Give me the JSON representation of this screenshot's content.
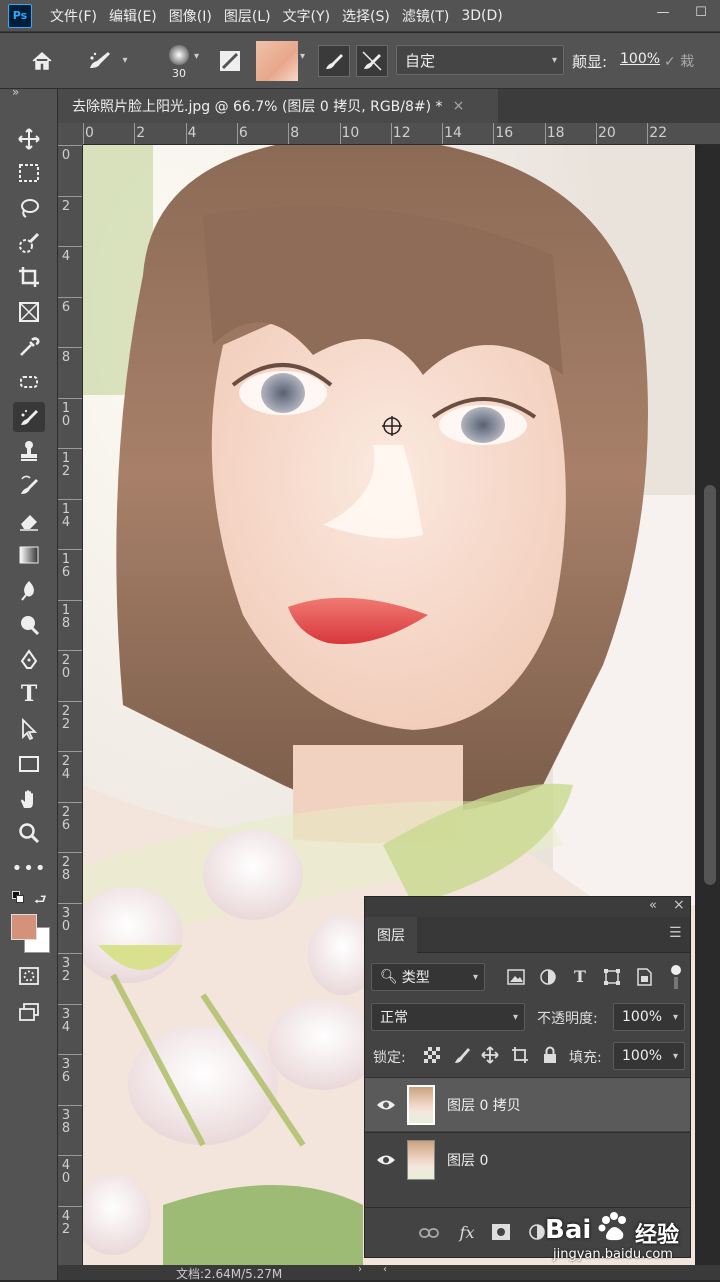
{
  "app": {
    "logo": "Ps"
  },
  "menu": [
    "文件(F)",
    "编辑(E)",
    "图像(I)",
    "图层(L)",
    "文字(Y)",
    "选择(S)",
    "滤镜(T)",
    "3D(D)"
  ],
  "window_controls": {
    "minimize": "—",
    "maximize": "☐"
  },
  "options": {
    "brush_size": "30",
    "preset": "自定",
    "sample_label": "颠显:",
    "zoom_percent": "100%",
    "tail": "✓ 栽"
  },
  "document_tab": {
    "title": "去除照片脸上阳光.jpg @ 66.7% (图层 0 拷贝, RGB/8#) *",
    "close": "×"
  },
  "hruler_ticks": [
    "0",
    "2",
    "4",
    "6",
    "8",
    "10",
    "12",
    "14",
    "16",
    "18",
    "20",
    "22"
  ],
  "vruler_ticks": [
    "0",
    "2",
    "4",
    "6",
    "8",
    "1 0",
    "1 2",
    "1 4",
    "1 6",
    "1 8",
    "2 0",
    "2 2",
    "2 4",
    "2 6",
    "2 8",
    "3 0",
    "3 2",
    "3 4",
    "3 6",
    "3 8",
    "4 0",
    "4 2"
  ],
  "colors": {
    "foreground": "#d4927a",
    "background": "#ffffff",
    "accent": "#31a8ff"
  },
  "status": {
    "doc_size": "文档:2.64M/5.27M"
  },
  "layers_panel": {
    "collapse": "«",
    "close": "×",
    "tab_label": "图层",
    "filter_kind": "类型",
    "blend_mode": "正常",
    "opacity_label": "不透明度:",
    "opacity_value": "100%",
    "lock_label": "锁定:",
    "fill_label": "填充:",
    "fill_value": "100%",
    "layers": [
      {
        "name": "图层 0 拷贝",
        "visible": true,
        "selected": true
      },
      {
        "name": "图层 0",
        "visible": true,
        "selected": false
      }
    ],
    "fx_label": "fx"
  },
  "watermark": {
    "brand": "Bai",
    "brand2": "经验",
    "url": "jingyan.baidu.com"
  }
}
